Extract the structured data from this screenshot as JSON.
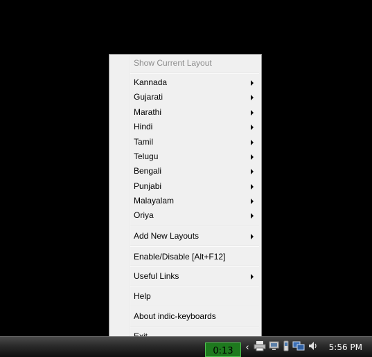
{
  "menu": {
    "header": "Show Current Layout",
    "languages": [
      {
        "label": "Kannada"
      },
      {
        "label": "Gujarati"
      },
      {
        "label": "Marathi"
      },
      {
        "label": "Hindi"
      },
      {
        "label": "Tamil"
      },
      {
        "label": "Telugu"
      },
      {
        "label": "Bengali"
      },
      {
        "label": "Punjabi"
      },
      {
        "label": "Malayalam"
      },
      {
        "label": "Oriya"
      }
    ],
    "add_new_layouts": "Add New Layouts",
    "enable_disable": "Enable/Disable [Alt+F12]",
    "useful_links": "Useful Links",
    "help": "Help",
    "about": "About indic-keyboards",
    "exit": "Exit"
  },
  "taskbar": {
    "app_text": "0:13",
    "clock": "5:56 PM",
    "tray_icons": [
      "chevron-left-icon",
      "printer-icon",
      "network-icon",
      "phone-icon",
      "network-status-icon",
      "volume-icon"
    ],
    "app_color": "#1e7a1e"
  }
}
